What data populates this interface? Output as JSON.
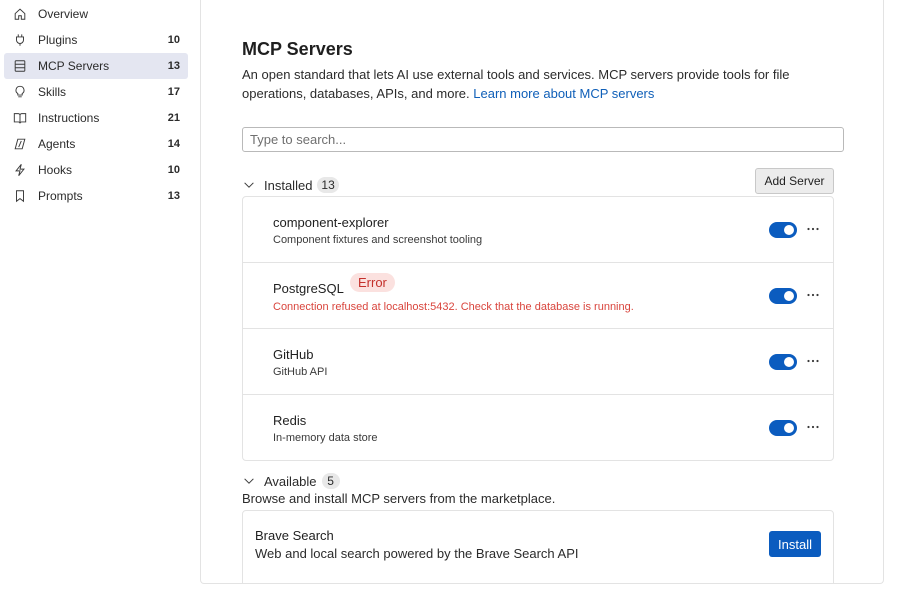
{
  "sidebar": {
    "items": [
      {
        "label": "Overview",
        "count": "",
        "icon": "home-icon"
      },
      {
        "label": "Plugins",
        "count": "10",
        "icon": "plug-icon"
      },
      {
        "label": "MCP Servers",
        "count": "13",
        "icon": "server-icon",
        "active": true
      },
      {
        "label": "Skills",
        "count": "17",
        "icon": "lightbulb-icon"
      },
      {
        "label": "Instructions",
        "count": "21",
        "icon": "book-icon"
      },
      {
        "label": "Agents",
        "count": "14",
        "icon": "agent-icon"
      },
      {
        "label": "Hooks",
        "count": "10",
        "icon": "lightning-icon"
      },
      {
        "label": "Prompts",
        "count": "13",
        "icon": "bookmark-icon"
      }
    ]
  },
  "main": {
    "title": "MCP Servers",
    "description": "An open standard that lets AI use external tools and services. MCP servers provide tools for file operations, databases, APIs, and more.",
    "learn_more": "Learn more about MCP servers",
    "search_placeholder": "Type to search...",
    "installed": {
      "label": "Installed",
      "count": "13",
      "add_button": "Add Server",
      "servers": [
        {
          "name": "component-explorer",
          "description": "Component fixtures and screenshot tooling",
          "enabled": true
        },
        {
          "name": "PostgreSQL",
          "badge": "Error",
          "error": "Connection refused at localhost:5432. Check that the database is running.",
          "enabled": true
        },
        {
          "name": "GitHub",
          "description": "GitHub API",
          "enabled": true
        },
        {
          "name": "Redis",
          "description": "In-memory data store",
          "enabled": true
        }
      ]
    },
    "available": {
      "label": "Available",
      "count": "5",
      "description": "Browse and install MCP servers from the marketplace.",
      "items": [
        {
          "name": "Brave Search",
          "description": "Web and local search powered by the Brave Search API",
          "button": "Install"
        }
      ]
    }
  },
  "colors": {
    "accent": "#0b5cbf",
    "link": "#0f5fb8",
    "error_text": "#d9453d",
    "error_badge_bg": "#fbe1df",
    "active_nav_bg": "#e4e6f1"
  }
}
